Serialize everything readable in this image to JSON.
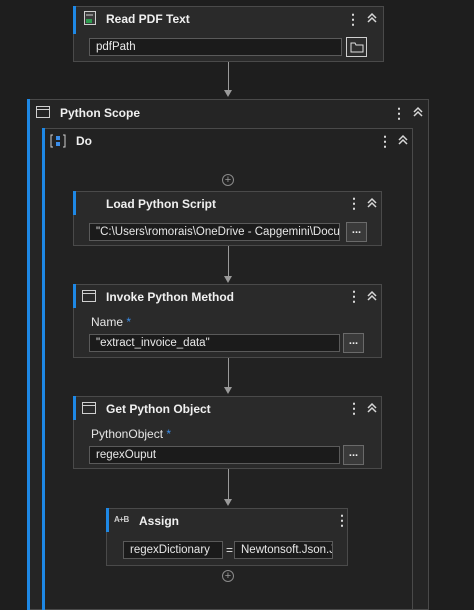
{
  "read_pdf": {
    "title": "Read PDF Text",
    "value": "pdfPath",
    "icon": "pdf-document-icon",
    "browse_icon": "folder-icon"
  },
  "python_scope": {
    "title": "Python Scope",
    "icon": "window-icon"
  },
  "do_sequence": {
    "title": "Do",
    "icon": "sequence-icon"
  },
  "load_script": {
    "title": "Load Python Script",
    "value": "\"C:\\Users\\romorais\\OneDrive - Capgemini\\Docum",
    "browse_label": "..."
  },
  "invoke_method": {
    "title": "Invoke Python Method",
    "name_label": "Name",
    "required_mark": "*",
    "value": "\"extract_invoice_data\"",
    "browse_label": "...",
    "icon": "window-icon"
  },
  "get_object": {
    "title": "Get Python Object",
    "field_label": "PythonObject",
    "required_mark": "*",
    "value": "regexOuput",
    "browse_label": "...",
    "icon": "window-icon"
  },
  "assign": {
    "title": "Assign",
    "icon_text": "A+B",
    "left_value": "regexDictionary",
    "operator": "=",
    "right_value": "Newtonsoft.Json.Js"
  },
  "glyphs": {
    "kebab": "⋮",
    "plus": "+"
  },
  "colors": {
    "accent": "#1e88e5",
    "background": "#1e1e1e",
    "card": "#2a2a2a"
  }
}
